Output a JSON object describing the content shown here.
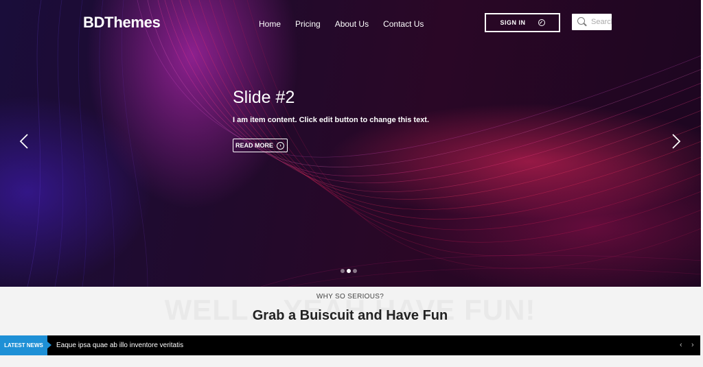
{
  "header": {
    "logo": "BDThemes",
    "nav": [
      "Home",
      "Pricing",
      "About Us",
      "Contact Us"
    ],
    "signin_label": "SIGN IN",
    "search_placeholder": "Search"
  },
  "slider": {
    "title": "Slide #2",
    "text": "I am item content. Click edit button to change this text.",
    "button_label": "READ MORE",
    "slide_count": 3,
    "active_slide": 2
  },
  "section": {
    "eyebrow": "WHY SO SERIOUS?",
    "background_text": "WELL... YEAH HAVE FUN!",
    "heading": "Grab a Buiscuit and Have Fun"
  },
  "ticker": {
    "label": "LATEST NEWS",
    "item": "Eaque ipsa quae ab illo inventore veritatis"
  },
  "colors": {
    "accent": "#1e90d6",
    "hero_pink": "#f0285f",
    "hero_magenta": "#e632dc",
    "hero_purple": "#461ec8"
  }
}
